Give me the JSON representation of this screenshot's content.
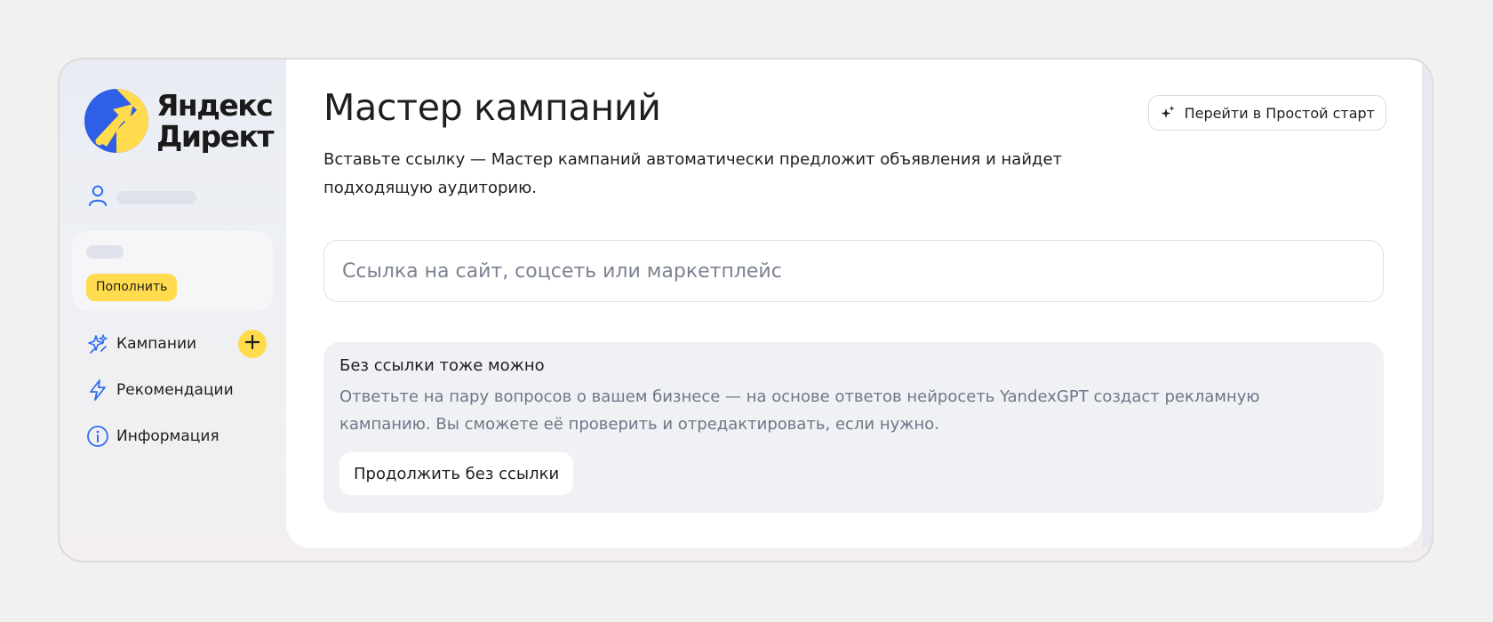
{
  "sidebar": {
    "logo": {
      "line1": "Яндекс",
      "line2": "Директ",
      "mark_colors": [
        "#2f5fe6",
        "#ffdb4d"
      ]
    },
    "user": {
      "icon": "user-icon"
    },
    "balance": {
      "topup_label": "Пополнить"
    },
    "nav": [
      {
        "label": "Кампании",
        "icon": "campaigns-sparkle-icon",
        "action_icon": "plus-icon"
      },
      {
        "label": "Рекомендации",
        "icon": "lightning-icon"
      },
      {
        "label": "Информация",
        "icon": "info-icon"
      }
    ]
  },
  "main": {
    "title": "Мастер кампаний",
    "subtitle": "Вставьте ссылку — Мастер кампаний автоматически предложит объявления и найдет подходящую аудиторию.",
    "simple_start_button": {
      "label": "Перейти в Простой старт",
      "icon": "sparkle-icon"
    },
    "url_input": {
      "value": "",
      "placeholder": "Ссылка на сайт, соцсеть или маркетплейс"
    },
    "no_link_card": {
      "title": "Без ссылки тоже можно",
      "text": "Ответьте на пару вопросов о вашем бизнесе — на основе ответов нейросеть YandexGPT создаст рекламную кампанию. Вы сможете её проверить и отредактировать, если нужно.",
      "button_label": "Продолжить без ссылки"
    }
  },
  "colors": {
    "accent_yellow": "#ffdb4d",
    "brand_blue": "#2f5fe6",
    "muted_text": "#6f7686",
    "card_bg": "#eff1f5"
  }
}
